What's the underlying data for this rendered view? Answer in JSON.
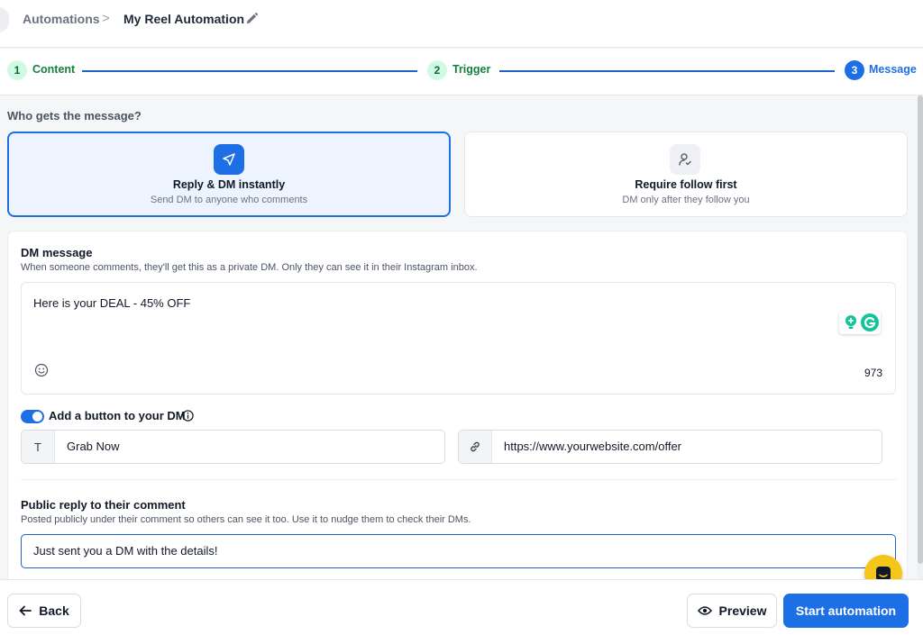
{
  "header": {
    "breadcrumb_root": "Automations",
    "breadcrumb_separator": ">",
    "title": "My Reel Automation"
  },
  "stepper": {
    "steps": [
      {
        "number": "1",
        "label": "Content",
        "state": "complete"
      },
      {
        "number": "2",
        "label": "Trigger",
        "state": "complete"
      },
      {
        "number": "3",
        "label": "Message",
        "state": "active"
      }
    ]
  },
  "audience": {
    "question": "Who gets the message?",
    "options": [
      {
        "title": "Reply & DM instantly",
        "subtitle": "Send DM to anyone who comments",
        "icon": "send-icon",
        "selected": true
      },
      {
        "title": "Require follow first",
        "subtitle": "DM only after they follow you",
        "icon": "user-follow-icon",
        "selected": false
      }
    ]
  },
  "dm": {
    "heading": "DM message",
    "help": "When someone comments, they'll get this as a private DM. Only they can see it in their Instagram inbox.",
    "message": "Here is your DEAL - 45% OFF",
    "char_count": "973"
  },
  "dm_button": {
    "enabled": true,
    "label": "Add a button to your DM",
    "text_prefix": "T",
    "text_value": "Grab Now",
    "url_value": "https://www.yourwebsite.com/offer"
  },
  "public_reply": {
    "heading": "Public reply to their comment",
    "help": "Posted publicly under their comment so others can see it too. Use it to nudge them to check their DMs.",
    "value": "Just sent you a DM with the details!"
  },
  "footer": {
    "back_label": "Back",
    "preview_label": "Preview",
    "start_label": "Start automation"
  },
  "colors": {
    "accent": "#1d6fe6",
    "step_done_bg": "#d1fae5",
    "step_done_text": "#15803d",
    "chat_bubble": "#f5c518",
    "grammarly": "#15c39a"
  }
}
